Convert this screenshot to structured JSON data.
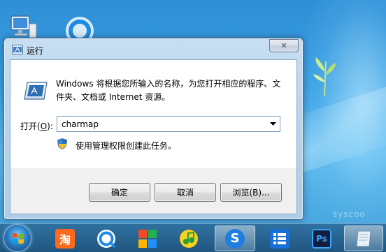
{
  "dialog": {
    "title": "运行",
    "description": "Windows 将根据您所输入的名称，为您打开相应的程序、文件夹、文档或 Internet 资源。",
    "open_label_prefix": "打开(",
    "open_label_key": "O",
    "open_label_suffix": "):",
    "input_value": "charmap",
    "admin_notice": "使用管理权限创建此任务。",
    "buttons": {
      "ok": "确定",
      "cancel": "取消",
      "browse": "浏览(B)..."
    },
    "close_icon": "close-icon"
  },
  "taskbar": {
    "items": [
      {
        "name": "start-button"
      },
      {
        "name": "taobao-app",
        "label": "淘"
      },
      {
        "name": "qq-browser-app"
      },
      {
        "name": "tiles-app"
      },
      {
        "name": "music-app"
      },
      {
        "name": "sogou-app",
        "label": "S"
      },
      {
        "name": "list-app"
      },
      {
        "name": "photoshop-app",
        "label": "Ps"
      },
      {
        "name": "notes-app"
      }
    ]
  },
  "desktop": {
    "watermark": "syscoo"
  },
  "colors": {
    "desktop_blue": "#3aa0e4",
    "dialog_frame": "#b9d4ec",
    "button_face": "#e6e6e6"
  }
}
